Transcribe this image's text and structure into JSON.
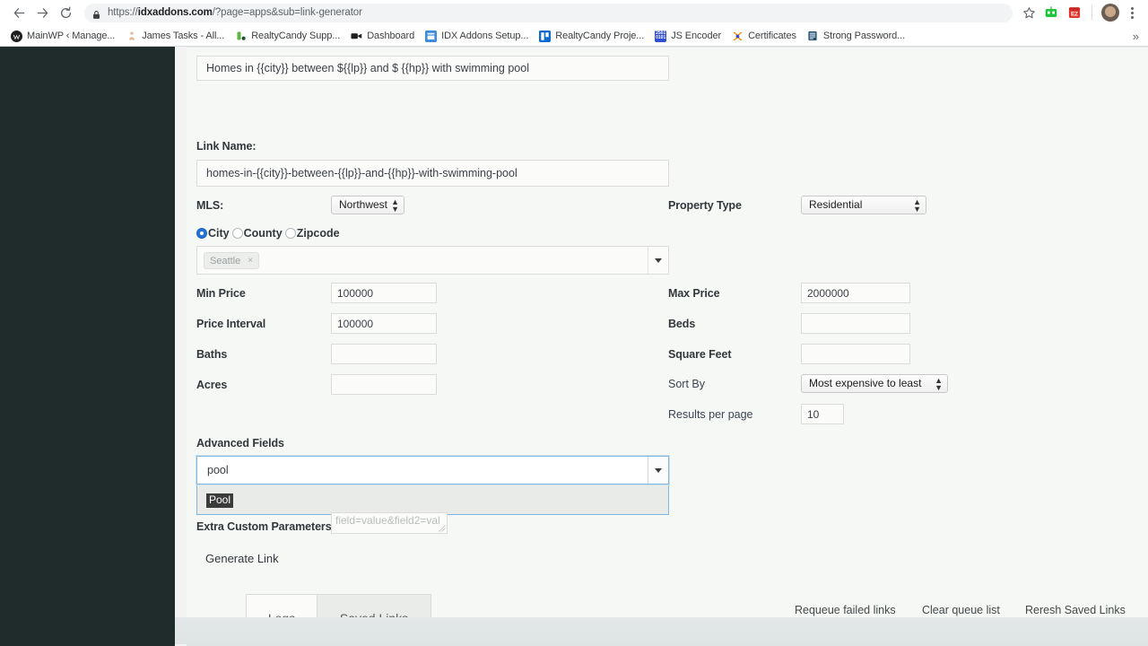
{
  "browser": {
    "nav": {
      "back_icon": "arrow-left-icon",
      "forward_icon": "arrow-right-icon",
      "reload_icon": "reload-icon",
      "lock_icon": "lock-icon",
      "star_icon": "star-icon",
      "menu_icon": "kebab-menu-icon"
    },
    "url": {
      "full": "https://idxaddons.com/?page=apps&sub=link-generator",
      "scheme": "https://",
      "domain": "idxaddons.com",
      "path": "/?page=apps&sub=link-generator"
    },
    "extensions": [
      {
        "name": "robot-extension-icon",
        "label": "",
        "color": "#21c43e"
      },
      {
        "name": "calendar-extension-icon",
        "label": "EZ",
        "color": "#e2342f"
      }
    ],
    "bookmarks": [
      {
        "label": "MainWP ‹ Manage...",
        "favicon": "mainwp-favicon",
        "color": "#2a2a2a"
      },
      {
        "label": "James Tasks - All...",
        "favicon": "asana-favicon",
        "color": "#f0b9a0"
      },
      {
        "label": "RealtyCandy Supp...",
        "favicon": "realtycandy-favicon",
        "color": "#5db544"
      },
      {
        "label": "Dashboard",
        "favicon": "video-favicon",
        "color": "#1f1f1f"
      },
      {
        "label": "IDX Addons Setup...",
        "favicon": "idx-favicon",
        "color": "#3d8ddd"
      },
      {
        "label": "RealtyCandy Proje...",
        "favicon": "trello-favicon",
        "color": "#0d6bcf"
      },
      {
        "label": "JS Encoder",
        "favicon": "jsencoder-favicon",
        "color": "#2f4fd0"
      },
      {
        "label": "Certificates",
        "favicon": "firefox-favicon",
        "color": "#ff8a00"
      },
      {
        "label": "Strong Password...",
        "favicon": "password-favicon",
        "color": "#1d4d73"
      }
    ],
    "overflow_label": "»"
  },
  "form": {
    "title_value": "Homes in {{city}} between ${{lp}} and $ {{hp}} with swimming pool",
    "link_name_label": "Link Name:",
    "link_name_value": "homes-in-{{city}}-between-{{lp}}-and-{{hp}}-with-swimming-pool",
    "mls_label": "MLS:",
    "mls_value": "Northwest",
    "property_type_label": "Property Type",
    "property_type_value": "Residential",
    "location_mode": [
      {
        "label": "City",
        "selected": true
      },
      {
        "label": "County",
        "selected": false
      },
      {
        "label": "Zipcode",
        "selected": false
      }
    ],
    "city_tag": "Seattle",
    "city_tag_remove": "×",
    "min_price_label": "Min Price",
    "min_price_value": "100000",
    "max_price_label": "Max Price",
    "max_price_value": "2000000",
    "price_interval_label": "Price Interval",
    "price_interval_value": "100000",
    "beds_label": "Beds",
    "beds_value": "",
    "baths_label": "Baths",
    "baths_value": "",
    "square_feet_label": "Square Feet",
    "square_feet_value": "",
    "acres_label": "Acres",
    "acres_value": "",
    "sort_by_label": "Sort By",
    "sort_by_value": "Most expensive to least",
    "results_per_page_label": "Results per page",
    "results_per_page_value": "10",
    "advanced_fields_label": "Advanced Fields",
    "advanced_fields_query": "pool",
    "advanced_fields_option": "Pool",
    "extra_custom_params_label": "Extra Custom Parameters",
    "extra_custom_params_placeholder": "field=value&field2=val",
    "generate_link_label": "Generate Link"
  },
  "tabs": [
    {
      "label": "Logs",
      "active": true
    },
    {
      "label": "Saved Links",
      "active": false
    }
  ],
  "actions": [
    {
      "label": "Requeue failed links"
    },
    {
      "label": "Clear queue list"
    },
    {
      "label": "Reresh Saved Links"
    }
  ]
}
